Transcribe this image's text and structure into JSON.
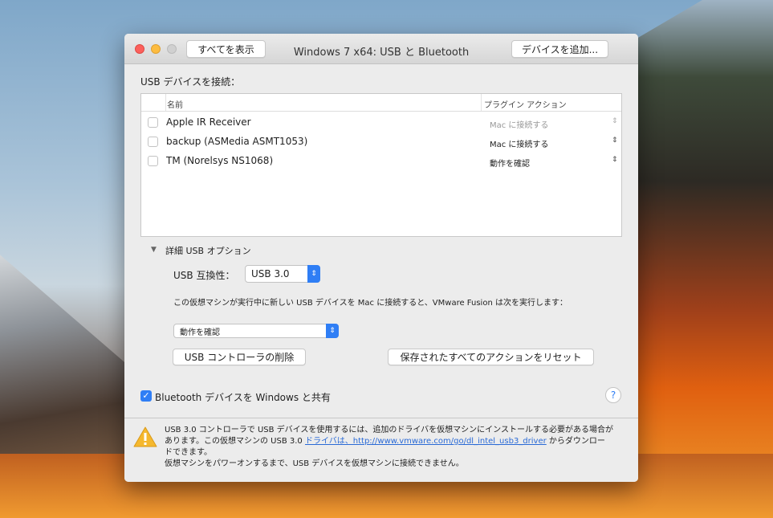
{
  "window": {
    "title": "Windows 7 x64: USB と Bluetooth",
    "show_all": "すべてを表示",
    "add_device": "デバイスを追加..."
  },
  "usb": {
    "section_label": "USB デバイスを接続：",
    "col_name": "名前",
    "col_action": "プラグイン アクション",
    "devices": [
      {
        "name": "Apple IR Receiver",
        "action": "Mac に接続する",
        "enabled": false
      },
      {
        "name": "backup (ASMedia ASMT1053)",
        "action": "Mac に接続する",
        "enabled": true
      },
      {
        "name": "TM (Norelsys NS1068)",
        "action": "動作を確認",
        "enabled": true
      }
    ]
  },
  "advanced": {
    "toggle": "詳細 USB オプション",
    "compat_label": "USB 互換性：",
    "compat_value": "USB 3.0",
    "desc": "この仮想マシンが実行中に新しい USB デバイスを Mac に接続すると、VMware Fusion は次を実行します：",
    "new_device_action": "動作を確認",
    "remove_controller": "USB コントローラの削除",
    "reset_actions": "保存されたすべてのアクションをリセット"
  },
  "bluetooth": {
    "label": "Bluetooth デバイスを Windows と共有",
    "checked": true
  },
  "help": "?",
  "warning": {
    "line1": "USB 3.0 コントローラで USB デバイスを使用するには、追加のドライバを仮想マシンにインストールする必要がある場合が",
    "line2a": "あります。この仮想マシンの USB 3.0 ",
    "link": "ドライバは、http://www.vmware.com/go/dl_intel_usb3_driver",
    "line2b": " からダウンロー",
    "line3": "ドできます。",
    "line4": "仮想マシンをパワーオンするまで、USB デバイスを仮想マシンに接続できません。"
  }
}
